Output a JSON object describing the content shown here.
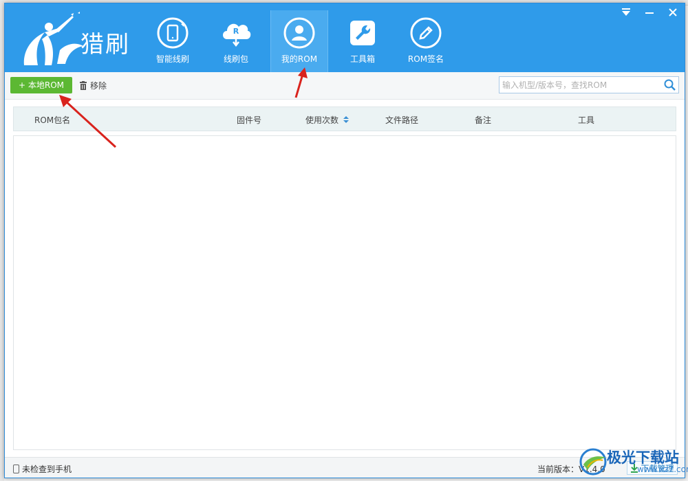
{
  "app": {
    "logo_text": "猎刷"
  },
  "nav": {
    "items": [
      {
        "label": "智能线刷",
        "icon": "phone-refresh-icon"
      },
      {
        "label": "线刷包",
        "icon": "cloud-download-icon"
      },
      {
        "label": "我的ROM",
        "icon": "user-icon",
        "active": true
      },
      {
        "label": "工具箱",
        "icon": "wrench-icon"
      },
      {
        "label": "ROM签名",
        "icon": "pen-icon"
      }
    ]
  },
  "toolbar": {
    "add_label": "+ 本地ROM",
    "remove_label": "移除",
    "search_placeholder": "输入机型/版本号，查找ROM"
  },
  "table": {
    "columns": [
      "ROM包名",
      "固件号",
      "使用次数",
      "文件路径",
      "备注",
      "工具"
    ],
    "rows": []
  },
  "status": {
    "device_status": "未检查到手机",
    "version_label": "当前版本：V1.4.0",
    "download_label": "下载管理"
  },
  "watermark": {
    "text": "极光下载站",
    "url": "www.xz7.com"
  },
  "colors": {
    "header_blue": "#2f9bea",
    "active_tab": "#4aabef",
    "add_button_green": "#5cb833",
    "annotation_red": "#d9231d"
  }
}
